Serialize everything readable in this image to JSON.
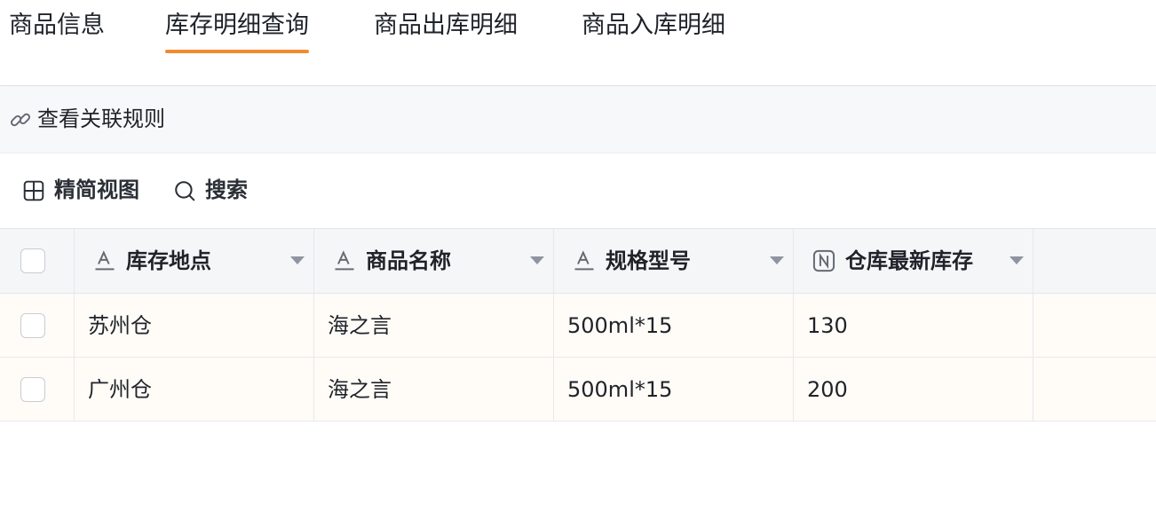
{
  "tabs": [
    {
      "label": "商品信息",
      "active": false
    },
    {
      "label": "库存明细查询",
      "active": true
    },
    {
      "label": "商品出库明细",
      "active": false
    },
    {
      "label": "商品入库明细",
      "active": false
    }
  ],
  "rulebar": {
    "label": "查看关联规则",
    "icon": "link-icon"
  },
  "toolbar": {
    "compact_view": {
      "label": "精简视图",
      "icon": "grid-icon"
    },
    "search": {
      "label": "搜索",
      "icon": "search-icon"
    }
  },
  "table": {
    "columns": [
      {
        "label": "库存地点",
        "type_icon": "text-field-icon"
      },
      {
        "label": "商品名称",
        "type_icon": "text-field-icon"
      },
      {
        "label": "规格型号",
        "type_icon": "text-field-icon"
      },
      {
        "label": "仓库最新库存",
        "type_icon": "number-field-icon"
      }
    ],
    "rows": [
      [
        "苏州仓",
        "海之言",
        "500ml*15",
        "130"
      ],
      [
        "广州仓",
        "海之言",
        "500ml*15",
        "200"
      ]
    ]
  },
  "colors": {
    "accent": "#f28b30",
    "header_bg": "#f5f6f8",
    "row_bg": "#fffcf8"
  }
}
